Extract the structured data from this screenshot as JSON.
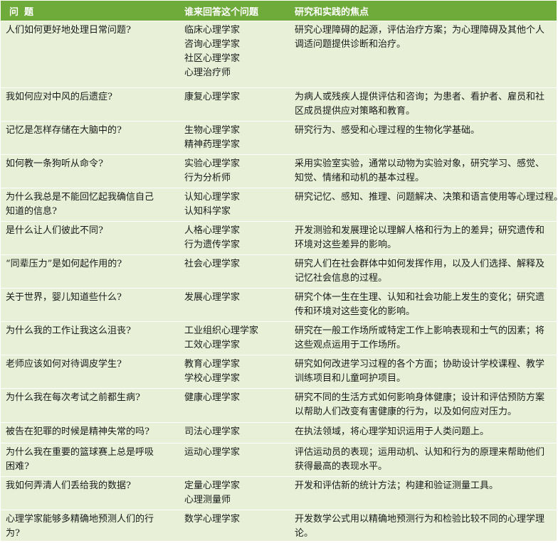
{
  "header": {
    "question": "问题",
    "who": "谁来回答这个问题",
    "focus": "研究和实践的焦点"
  },
  "rows": [
    {
      "q": [
        "人们如何更好地处理日常问题?"
      ],
      "who": [
        "临床心理学家",
        "咨询心理学家",
        "社区心理学家",
        "心理治疗师"
      ],
      "focus": [
        "研究心理障碍的起源，评估治疗方案；为心理障碍及其他个人",
        "调适问题提供诊断和治疗。"
      ]
    },
    {
      "q": [
        "我如何应对中风的后遗症?"
      ],
      "who": [
        "康复心理学家"
      ],
      "focus": [
        "为病人或残疾人提供评估和咨询；为患者、看护者、雇员和社",
        "区成员提供应对策略和教育。"
      ]
    },
    {
      "q": [
        "记忆是怎样存储在大脑中的?"
      ],
      "who": [
        "生物心理学家",
        "精神药理学家"
      ],
      "focus": [
        "研究行为、感受和心理过程的生物化学基础。"
      ]
    },
    {
      "q": [
        "如何教一条狗听从命令?"
      ],
      "who": [
        "实验心理学家",
        "行为分析师"
      ],
      "focus": [
        "采用实验室实验，通常以动物为实验对象，研究学习、感觉、",
        "知觉、情绪和动机的基本过程。"
      ]
    },
    {
      "q": [
        "为什么我总是不能回忆起我确信自己",
        "知道的信息?"
      ],
      "who": [
        "认知心理学家",
        "认知科学家"
      ],
      "focus": [
        "研究记忆、感知、推理、问题解决、决策和语言使用等心理过程。"
      ]
    },
    {
      "q": [
        "是什么让人们彼此不同?"
      ],
      "who": [
        "人格心理学家",
        "行为遗传学家"
      ],
      "focus": [
        "开发测验和发展理论以理解人格和行为上的差异；研究遗传和",
        "环境对这些差异的影响。"
      ]
    },
    {
      "q": [
        "“同辈压力”是如何起作用的?"
      ],
      "who": [
        "社会心理学家"
      ],
      "focus": [
        "研究人们在社会群体中如何发挥作用，以及人们选择、解释及",
        "记忆社会信息的过程。"
      ]
    },
    {
      "q": [
        "关于世界，婴儿知道些什么?"
      ],
      "who": [
        "发展心理学家"
      ],
      "focus": [
        "研究个体一生在生理、认知和社会功能上发生的变化；研究遗",
        "传和环境对这些变化的影响。"
      ]
    },
    {
      "q": [
        "为什么我的工作让我这么沮丧?"
      ],
      "who": [
        "工业组织心理学家",
        "工效心理学家"
      ],
      "focus": [
        "研究在一般工作场所或特定工作上影响表现和士气的因素；将",
        "这些观点运用于工作场所。"
      ]
    },
    {
      "q": [
        "老师应该如何对待调皮学生?"
      ],
      "who": [
        "教育心理学家",
        "学校心理学家"
      ],
      "focus": [
        "研究如何改进学习过程的各个方面；协助设计学校课程、教学",
        "训练项目和儿童呵护项目。"
      ]
    },
    {
      "q": [
        "为什么我在每次考试之前都生病?"
      ],
      "who": [
        "健康心理学家"
      ],
      "focus": [
        "研究不同的生活方式如何影响身体健康；设计和评估预防方案",
        "以帮助人们改变有害健康的行为，以及如何应对压力。"
      ]
    },
    {
      "q": [
        "被告在犯罪的时候是精神失常的吗?"
      ],
      "who": [
        "司法心理学家"
      ],
      "focus": [
        "在执法领域，将心理学知识运用于人类问题上。"
      ]
    },
    {
      "q": [
        "为什么我在重要的篮球赛上总是呼吸",
        "困难?"
      ],
      "who": [
        "运动心理学家"
      ],
      "focus": [
        "评估运动员的表现；运用动机、认知和行为的原理来帮助他们",
        "获得最高的表现水平。"
      ]
    },
    {
      "q": [
        "我如何弄清人们丢给我的数据?"
      ],
      "who": [
        "定量心理学家",
        "心理测量师"
      ],
      "focus": [
        "开发和评估新的统计方法；构建和验证测量工具。"
      ]
    },
    {
      "q": [
        "心理学家能够多精确地预测人们的行",
        "为?"
      ],
      "who": [
        "数学心理学家"
      ],
      "focus": [
        "开发数学公式用以精确地预测行为和检验比较不同的心理学理",
        "论。"
      ]
    }
  ]
}
